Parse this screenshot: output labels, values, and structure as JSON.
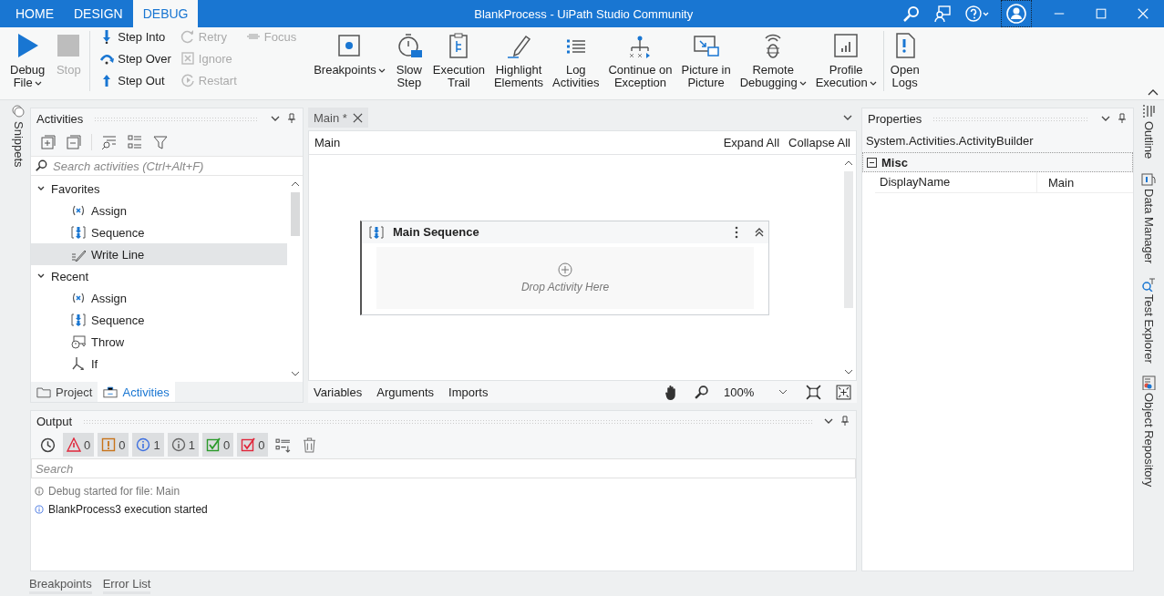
{
  "window": {
    "title": "BlankProcess - UiPath Studio Community"
  },
  "menu_tabs": [
    {
      "label": "HOME",
      "selected": false
    },
    {
      "label": "DESIGN",
      "selected": false
    },
    {
      "label": "DEBUG",
      "selected": true
    }
  ],
  "ribbon": {
    "groups": [
      {
        "items": [
          {
            "kind": "large",
            "label": "Debug\nFile",
            "dropdown": true,
            "disabled": false
          },
          {
            "kind": "large",
            "label": "Stop",
            "dropdown": false,
            "disabled": true
          }
        ]
      },
      {
        "items": [
          {
            "kind": "small",
            "label": "Step Into",
            "disabled": false
          },
          {
            "kind": "small",
            "label": "Step Over",
            "disabled": false
          },
          {
            "kind": "small",
            "label": "Step Out",
            "disabled": false
          },
          {
            "kind": "small",
            "label": "Retry",
            "disabled": true
          },
          {
            "kind": "small",
            "label": "Ignore",
            "disabled": true
          },
          {
            "kind": "small",
            "label": "Restart",
            "disabled": true
          },
          {
            "kind": "small",
            "label": "Focus",
            "disabled": true
          }
        ]
      },
      {
        "items": [
          {
            "kind": "large",
            "label": "Breakpoints",
            "dropdown": true,
            "disabled": false
          },
          {
            "kind": "large",
            "label": "Slow\nStep",
            "dropdown": false,
            "disabled": false
          },
          {
            "kind": "large",
            "label": "Execution\nTrail",
            "dropdown": false,
            "disabled": false
          },
          {
            "kind": "large",
            "label": "Highlight\nElements",
            "dropdown": false,
            "disabled": false
          },
          {
            "kind": "large",
            "label": "Log\nActivities",
            "dropdown": false,
            "disabled": false
          },
          {
            "kind": "large",
            "label": "Continue on\nException",
            "dropdown": false,
            "disabled": false
          },
          {
            "kind": "large",
            "label": "Picture in\nPicture",
            "dropdown": false,
            "disabled": false
          },
          {
            "kind": "large",
            "label": "Remote\nDebugging",
            "dropdown": true,
            "disabled": false
          },
          {
            "kind": "large",
            "label": "Profile\nExecution",
            "dropdown": true,
            "disabled": false
          }
        ]
      },
      {
        "items": [
          {
            "kind": "large",
            "label": "Open\nLogs",
            "dropdown": false,
            "disabled": false
          }
        ]
      }
    ]
  },
  "left_strip": [
    {
      "label": "Snippets"
    }
  ],
  "activities": {
    "title": "Activities",
    "search": {
      "placeholder": "Search activities (Ctrl+Alt+F)"
    },
    "tree": [
      {
        "label": "Favorites",
        "expanded": true,
        "selected": false,
        "children": [
          {
            "label": "Assign",
            "kind": "assign",
            "selected": false
          },
          {
            "label": "Sequence",
            "kind": "sequence",
            "selected": false
          },
          {
            "label": "Write Line",
            "kind": "write-line",
            "selected": true
          }
        ]
      },
      {
        "label": "Recent",
        "expanded": true,
        "selected": false,
        "children": [
          {
            "label": "Assign",
            "kind": "assign",
            "selected": false
          },
          {
            "label": "Sequence",
            "kind": "sequence",
            "selected": false
          },
          {
            "label": "Throw",
            "kind": "throw",
            "selected": false
          },
          {
            "label": "If",
            "kind": "if",
            "selected": false
          }
        ]
      }
    ],
    "tabs": [
      {
        "label": "Project",
        "selected": false
      },
      {
        "label": "Activities",
        "selected": true
      }
    ]
  },
  "designer": {
    "tab": {
      "label": "Main *"
    },
    "breadcrumb": "Main",
    "expand_all": "Expand All",
    "collapse_all": "Collapse All",
    "sequence": {
      "title": "Main Sequence",
      "drop_hint": "Drop Activity Here"
    },
    "bottom_tabs": [
      "Variables",
      "Arguments",
      "Imports"
    ],
    "zoom": "100%"
  },
  "properties": {
    "title": "Properties",
    "object_type": "System.Activities.ActivityBuilder",
    "categories": [
      {
        "label": "Misc",
        "expanded": true,
        "rows": [
          {
            "name": "DisplayName",
            "value": "Main"
          }
        ]
      }
    ]
  },
  "right_strip": [
    {
      "label": "Outline"
    },
    {
      "label": "Data Manager"
    },
    {
      "label": "Test Explorer"
    },
    {
      "label": "Object Repository"
    }
  ],
  "output": {
    "title": "Output",
    "filters": [
      {
        "kind": "error",
        "count": "0",
        "on": true
      },
      {
        "kind": "warning",
        "count": "0",
        "on": true
      },
      {
        "kind": "info",
        "count": "1",
        "on": true
      },
      {
        "kind": "trace",
        "count": "1",
        "on": true
      },
      {
        "kind": "passed",
        "count": "0",
        "on": true
      },
      {
        "kind": "failed",
        "count": "0",
        "on": true
      }
    ],
    "search": {
      "placeholder": "Search"
    },
    "entries": [
      {
        "kind": "trace",
        "text": "Debug started for file: Main"
      },
      {
        "kind": "info",
        "text": "BlankProcess3 execution started"
      }
    ]
  },
  "bottom_tabs": [
    {
      "label": "Breakpoints"
    },
    {
      "label": "Error List"
    }
  ]
}
